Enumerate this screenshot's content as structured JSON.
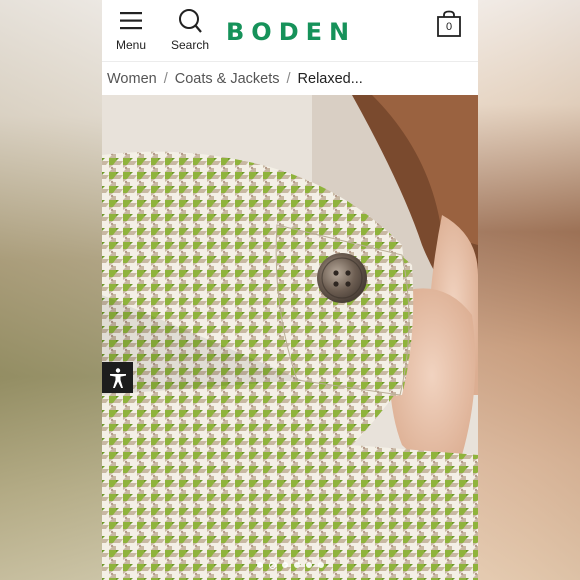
{
  "header": {
    "menu_label": "Menu",
    "search_label": "Search",
    "logo_text": "BODEN",
    "bag_count": "0",
    "brand_color": "#16925a"
  },
  "breadcrumb": {
    "items": [
      "Women",
      "Coats & Jackets"
    ],
    "current": "Relaxed..."
  },
  "gallery": {
    "slide_count": 6,
    "active_index": 1
  },
  "icons": {
    "menu": "hamburger-icon",
    "search": "search-icon",
    "bag": "shopping-bag-icon",
    "accessibility": "accessibility-icon"
  }
}
